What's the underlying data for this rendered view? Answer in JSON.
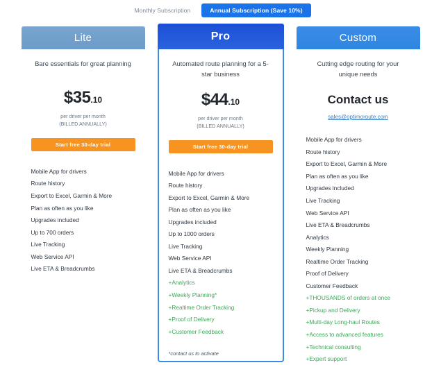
{
  "billing_toggle": {
    "monthly_label": "Monthly Subscription",
    "annual_label": "Annual Subscription (Save 10%)",
    "active": "annual",
    "active_color": "#1a73e8"
  },
  "plans": [
    {
      "id": "lite",
      "name": "Lite",
      "header_color": "#6b9bc9",
      "tagline": "Bare essentials for great planning",
      "price_amount": "$35",
      "price_cents": ".10",
      "price_note_line1": "per driver per month",
      "price_note_line2": "(BILLED ANNUALLY)",
      "cta_label": "Start free 30-day trial",
      "cta_color": "#f79421",
      "features": [
        {
          "text": "Mobile App for drivers",
          "highlight": false
        },
        {
          "text": "Route history",
          "highlight": false
        },
        {
          "text": "Export to Excel, Garmin & More",
          "highlight": false
        },
        {
          "text": "Plan as often as you like",
          "highlight": false
        },
        {
          "text": "Upgrades included",
          "highlight": false
        },
        {
          "text": "Up to 700 orders",
          "highlight": false
        },
        {
          "text": "Live Tracking",
          "highlight": false
        },
        {
          "text": "Web Service API",
          "highlight": false
        },
        {
          "text": "Live ETA & Breadcrumbs",
          "highlight": false
        }
      ],
      "footnote": ""
    },
    {
      "id": "pro",
      "name": "Pro",
      "header_color": "#1c4fd6",
      "border_color": "#3a8dde",
      "tagline": "Automated route planning for a 5-star business",
      "price_amount": "$44",
      "price_cents": ".10",
      "price_note_line1": "per driver per month",
      "price_note_line2": "(BILLED ANNUALLY)",
      "cta_label": "Start free 30-day trial",
      "cta_color": "#f79421",
      "features": [
        {
          "text": "Mobile App for drivers",
          "highlight": false
        },
        {
          "text": "Route history",
          "highlight": false
        },
        {
          "text": "Export to Excel, Garmin & More",
          "highlight": false
        },
        {
          "text": "Plan as often as you like",
          "highlight": false
        },
        {
          "text": "Upgrades included",
          "highlight": false
        },
        {
          "text": "Up to 1000 orders",
          "highlight": false
        },
        {
          "text": "Live Tracking",
          "highlight": false
        },
        {
          "text": "Web Service API",
          "highlight": false
        },
        {
          "text": "Live ETA & Breadcrumbs",
          "highlight": false
        },
        {
          "text": "+Analytics",
          "highlight": true
        },
        {
          "text": "+Weekly Planning*",
          "highlight": true
        },
        {
          "text": "+Realtime Order Tracking",
          "highlight": true
        },
        {
          "text": "+Proof of Delivery",
          "highlight": true
        },
        {
          "text": "+Customer Feedback",
          "highlight": true
        }
      ],
      "footnote": "*contact us to activate"
    },
    {
      "id": "custom",
      "name": "Custom",
      "header_color": "#2e86e0",
      "tagline": "Cutting edge routing for your unique needs",
      "contact_heading": "Contact us",
      "contact_email": "sales@optimoroute.com",
      "features": [
        {
          "text": "Mobile App for drivers",
          "highlight": false
        },
        {
          "text": "Route history",
          "highlight": false
        },
        {
          "text": "Export to Excel, Garmin & More",
          "highlight": false
        },
        {
          "text": "Plan as often as you like",
          "highlight": false
        },
        {
          "text": "Upgrades included",
          "highlight": false
        },
        {
          "text": "Live Tracking",
          "highlight": false
        },
        {
          "text": "Web Service API",
          "highlight": false
        },
        {
          "text": "Live ETA & Breadcrumbs",
          "highlight": false
        },
        {
          "text": "Analytics",
          "highlight": false
        },
        {
          "text": "Weekly Planning",
          "highlight": false
        },
        {
          "text": "Realtime Order Tracking",
          "highlight": false
        },
        {
          "text": "Proof of Delivery",
          "highlight": false
        },
        {
          "text": "Customer Feedback",
          "highlight": false
        },
        {
          "text": "+THOUSANDS of orders at once",
          "highlight": true
        },
        {
          "text": "+Pickup and Delivery",
          "highlight": true
        },
        {
          "text": "+Multi-day Long-haul Routes",
          "highlight": true
        },
        {
          "text": "+Access to advanced features",
          "highlight": true
        },
        {
          "text": "+Technical consulting",
          "highlight": true
        },
        {
          "text": "+Expert support",
          "highlight": true
        }
      ],
      "footnote": ""
    }
  ]
}
